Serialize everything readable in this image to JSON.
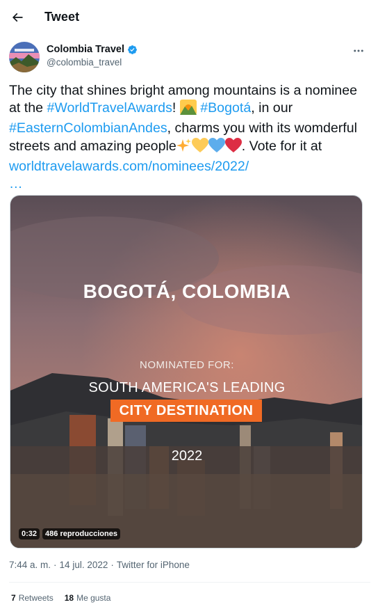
{
  "header": {
    "title": "Tweet",
    "back_icon": "arrow-left-icon"
  },
  "author": {
    "name": "Colombia Travel",
    "handle": "@colombia_travel",
    "verified_icon": "verified-badge-icon",
    "more_icon": "more-horizontal-icon"
  },
  "tweet": {
    "t1": "The city that shines bright among mountains is a nominee at the ",
    "hashtag1": "#WorldTravelAwards",
    "t2": "! ",
    "emoji1": "sunrise-over-mountains-emoji",
    "t3": " ",
    "hashtag2": "#Bogotá",
    "t4": ", in our ",
    "hashtag3": "#EasternColombianAndes",
    "t5": ", charms you with its womderful streets and amazing people",
    "emoji2": "sparkles-emoji",
    "emoji3": "yellow-heart-emoji",
    "emoji4": "blue-heart-emoji",
    "emoji5": "red-heart-emoji",
    "t6": ". Vote for it at ",
    "link": "worldtravelawards.com/nominees/2022/",
    "ellipsis": "…"
  },
  "media": {
    "title": "BOGOTÁ, COLOMBIA",
    "nominated_for": "NOMINATED FOR:",
    "category_line1": "SOUTH AMERICA'S LEADING",
    "category_line2": "CITY DESTINATION",
    "year": "2022",
    "duration": "0:32",
    "views": "486 reproducciones",
    "accent": "#f06a24"
  },
  "meta": {
    "time": "7:44 a. m.",
    "sep1": "·",
    "date": "14 jul. 2022",
    "sep2": "·",
    "source": "Twitter for iPhone"
  },
  "stats": {
    "retweets_count": "7",
    "retweets_label": "Retweets",
    "likes_count": "18",
    "likes_label": "Me gusta"
  },
  "colors": {
    "link": "#1d9bf0",
    "text": "#0f1419",
    "secondary": "#536471"
  }
}
